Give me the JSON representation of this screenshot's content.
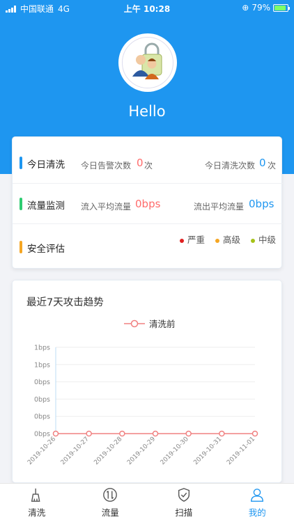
{
  "status_bar": {
    "carrier": "中国联通",
    "network": "4G",
    "time": "上午 10:28",
    "battery": "79%",
    "battery_level": 0.79
  },
  "profile": {
    "greeting": "Hello"
  },
  "summary": {
    "clean": {
      "title": "今日清洗",
      "alarm_label": "今日告警次数",
      "alarm_value": "0",
      "alarm_unit": "次",
      "clean_label": "今日清洗次数",
      "clean_value": "0",
      "clean_unit": "次"
    },
    "traffic": {
      "title": "流量监测",
      "in_label": "流入平均流量",
      "in_value": "0bps",
      "out_label": "流出平均流量",
      "out_value": "0bps"
    },
    "security": {
      "title": "安全评估",
      "levels": [
        {
          "label": "严重",
          "color": "#e02020"
        },
        {
          "label": "高级",
          "color": "#f5a623"
        },
        {
          "label": "中级",
          "color": "#a6c218"
        }
      ]
    }
  },
  "colors": {
    "accent": "#1e96f0",
    "clean_bar": "#1e96f0",
    "traffic_bar": "#2ecc71",
    "security_bar": "#f5a623",
    "alarm_value": "#ff6b6b",
    "clean_value": "#1e96f0",
    "in_value": "#ff6b6b",
    "out_value": "#1e96f0",
    "series": "#f08080"
  },
  "chart": {
    "title": "最近7天攻击趋势"
  },
  "chart_data": {
    "type": "line",
    "title": "最近7天攻击趋势",
    "x": [
      "2019-10-26",
      "2019-10-27",
      "2019-10-28",
      "2019-10-29",
      "2019-10-30",
      "2019-10-31",
      "2019-11-01"
    ],
    "y_tick_labels": [
      "0bps",
      "0bps",
      "0bps",
      "0bps",
      "1bps",
      "1bps"
    ],
    "series": [
      {
        "name": "清洗前",
        "values": [
          0,
          0,
          0,
          0,
          0,
          0,
          0
        ]
      }
    ],
    "legend": "top-center",
    "grid": true
  },
  "tabbar": {
    "items": [
      {
        "label": "清洗",
        "icon": "broom-icon",
        "active": false
      },
      {
        "label": "流量",
        "icon": "traffic-arrows-icon",
        "active": false
      },
      {
        "label": "扫描",
        "icon": "shield-check-icon",
        "active": false
      },
      {
        "label": "我的",
        "icon": "user-icon",
        "active": true
      }
    ]
  }
}
